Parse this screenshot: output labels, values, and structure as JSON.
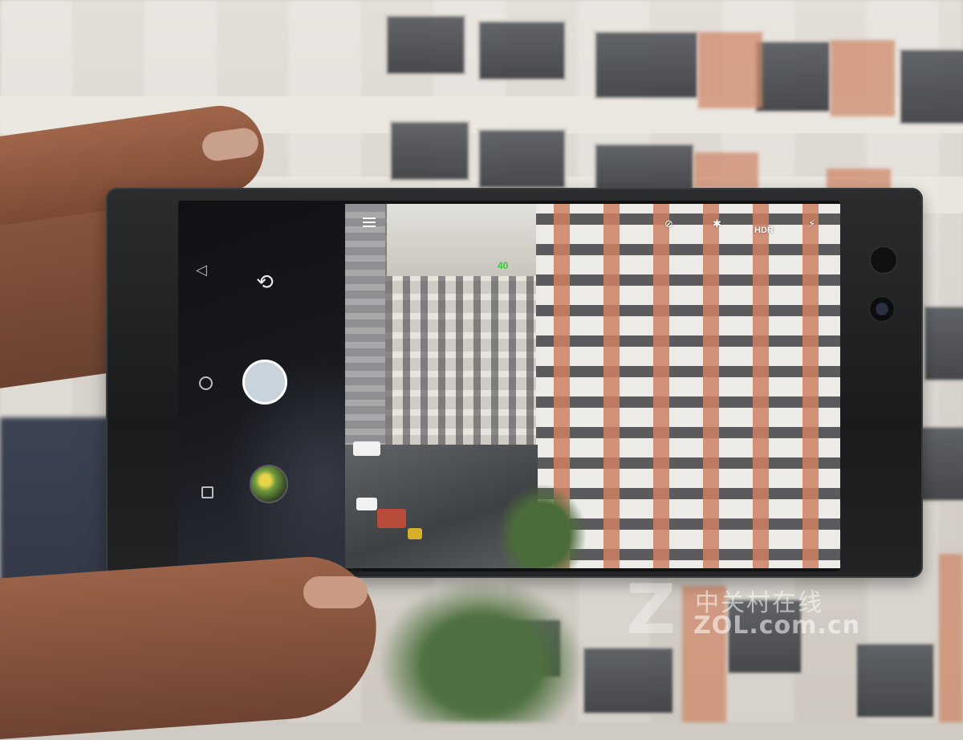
{
  "camera_ui": {
    "top_bar": {
      "menu_icon": "hamburger-menu-icon",
      "timer_icon": "timer-off-icon",
      "flash_icon": "flash-off-icon",
      "hdr_label": "HDR",
      "grid_icon": "grid-off-icon"
    },
    "focus_indicator": "40",
    "controls": {
      "switch_camera_icon": "switch-camera-icon",
      "shutter_icon": "shutter-button",
      "gallery_icon": "gallery-thumbnail"
    },
    "nav_bar": {
      "back_icon": "back-icon",
      "home_icon": "home-icon",
      "recents_icon": "recents-icon"
    }
  },
  "watermark": {
    "chinese_text": "中关村在线",
    "url_text": "ZOL.com.cn"
  }
}
